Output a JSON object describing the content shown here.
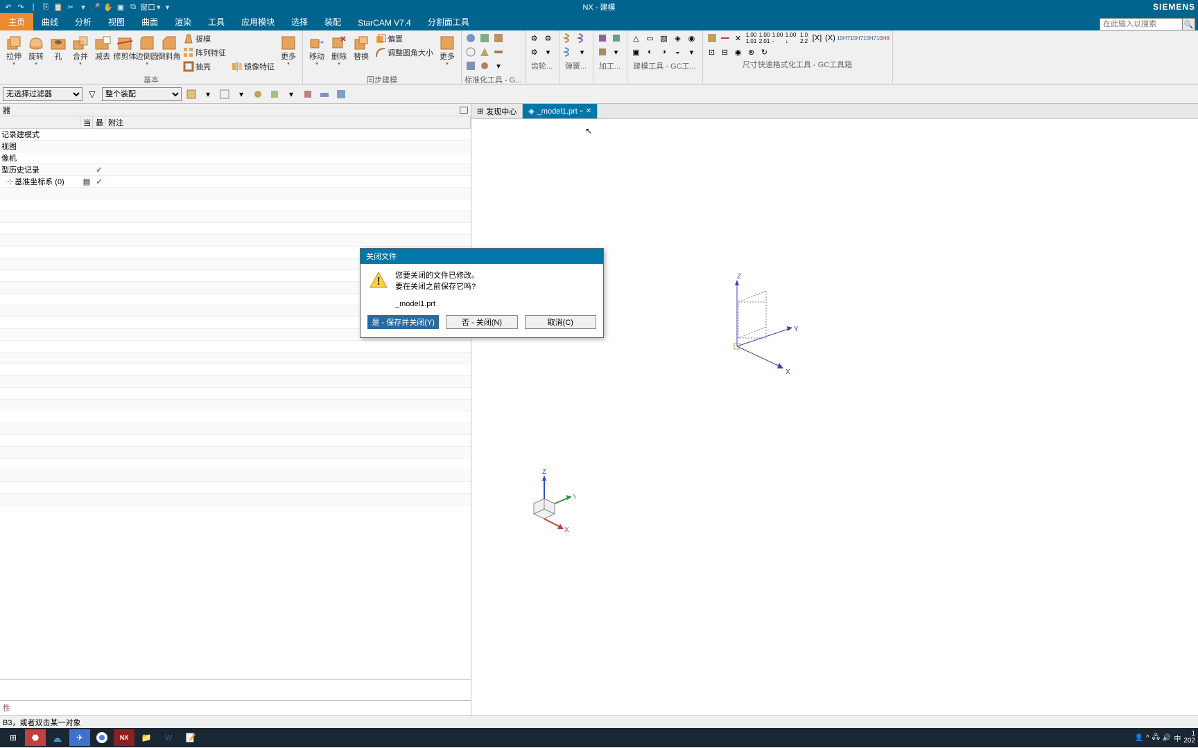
{
  "app": {
    "title": "NX - 建模",
    "brand": "SIEMENS"
  },
  "qat": {
    "window_label": "窗口"
  },
  "tabs": [
    "主页",
    "曲线",
    "分析",
    "视图",
    "曲面",
    "渲染",
    "工具",
    "应用模块",
    "选择",
    "装配",
    "StarCAM V7.4",
    "分割面工具"
  ],
  "active_tab": 0,
  "search_placeholder": "在此输入以搜索",
  "ribbon": {
    "g1_label": "基本",
    "btn_extrude": "拉伸",
    "btn_revolve": "旋转",
    "btn_hole": "孔",
    "btn_unite": "合并",
    "btn_subtract": "减去",
    "btn_trim": "修剪体",
    "btn_edgeblend": "边倒圆",
    "btn_chamfer": "倒斜角",
    "btn_draft": "拔模",
    "btn_pattern": "阵列特征",
    "btn_shell": "抽壳",
    "btn_mirror": "镜像特征",
    "btn_more1": "更多",
    "g2_label": "同步建模",
    "btn_move": "移动",
    "btn_delete": "删除",
    "btn_replace": "替换",
    "btn_resize": "调整圆角大小",
    "btn_offset": "偏置",
    "btn_more2": "更多",
    "g3_label": "标准化工具 - G...",
    "g4_label": "齿轮...",
    "g5_label": "弹簧...",
    "g6_label": "加工...",
    "g7_label": "建模工具 - GC工...",
    "g8_label": "尺寸快速格式化工具 - GC工具箱"
  },
  "selbar": {
    "filter1": "无选择过滤器",
    "filter2": "整个装配"
  },
  "left_panel": {
    "header": "器",
    "cols": [
      "当",
      "最",
      "附注"
    ],
    "rows": [
      {
        "name": "记录建模式",
        "c1": "",
        "c2": ""
      },
      {
        "name": "视图",
        "c1": "",
        "c2": ""
      },
      {
        "name": "像机",
        "c1": "",
        "c2": ""
      },
      {
        "name": "型历史记录",
        "c1": "",
        "c2": "✓"
      },
      {
        "name": "基准坐标系 (0)",
        "c1": "▤",
        "c2": "✓",
        "indent": true,
        "icon": true
      }
    ],
    "prop_label": "性"
  },
  "view_tabs": [
    {
      "label": "发现中心",
      "active": false
    },
    {
      "label": "_model1.prt",
      "active": true,
      "dirty": true
    }
  ],
  "dialog": {
    "title": "关闭文件",
    "line1": "您要关闭的文件已修改。",
    "line2": "要在关闭之前保存它吗?",
    "file": "_model1.prt",
    "btn_yes": "是 - 保存并关闭(Y)",
    "btn_no": "否 - 关闭(N)",
    "btn_cancel": "取消(C)"
  },
  "status": "B3，或者双击某一对象",
  "taskbar": {
    "ime": "中",
    "time_prefix": "1",
    "date_prefix": "202"
  },
  "axes": {
    "x": "X",
    "y": "Y",
    "z": "Z"
  }
}
